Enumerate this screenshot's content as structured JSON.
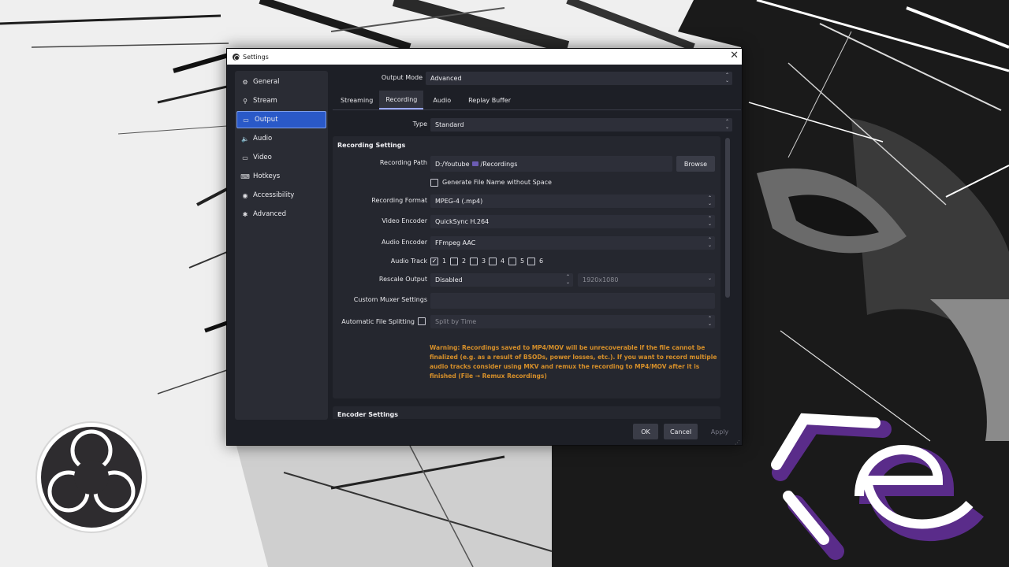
{
  "window": {
    "title": "Settings",
    "close_glyph": "✕"
  },
  "sidebar": {
    "items": [
      {
        "label": "General",
        "icon": "gear-icon",
        "glyph": "⚙"
      },
      {
        "label": "Stream",
        "icon": "antenna-icon",
        "glyph": "⚲"
      },
      {
        "label": "Output",
        "icon": "output-icon",
        "glyph": "▭",
        "active": true
      },
      {
        "label": "Audio",
        "icon": "speaker-icon",
        "glyph": "🔈"
      },
      {
        "label": "Video",
        "icon": "monitor-icon",
        "glyph": "▭"
      },
      {
        "label": "Hotkeys",
        "icon": "keyboard-icon",
        "glyph": "⌨"
      },
      {
        "label": "Accessibility",
        "icon": "accessibility-icon",
        "glyph": "◉"
      },
      {
        "label": "Advanced",
        "icon": "wrench-icon",
        "glyph": "✱"
      }
    ]
  },
  "output_mode": {
    "label": "Output Mode",
    "value": "Advanced"
  },
  "tabs": [
    "Streaming",
    "Recording",
    "Audio",
    "Replay Buffer"
  ],
  "type": {
    "label": "Type",
    "value": "Standard"
  },
  "recording": {
    "section_title": "Recording Settings",
    "path_label": "Recording Path",
    "path_part1": "D:/Youtube",
    "path_part2": "/Recordings",
    "browse_label": "Browse",
    "gen_filename_label": "Generate File Name without Space",
    "format_label": "Recording Format",
    "format_value": "MPEG-4 (.mp4)",
    "video_encoder_label": "Video Encoder",
    "video_encoder_value": "QuickSync H.264",
    "audio_encoder_label": "Audio Encoder",
    "audio_encoder_value": "FFmpeg AAC",
    "audio_track_label": "Audio Track",
    "tracks": [
      {
        "label": "1",
        "checked": true
      },
      {
        "label": "2",
        "checked": false
      },
      {
        "label": "3",
        "checked": false
      },
      {
        "label": "4",
        "checked": false
      },
      {
        "label": "5",
        "checked": false
      },
      {
        "label": "6",
        "checked": false
      }
    ],
    "check_glyph": "✓",
    "rescale_label": "Rescale Output",
    "rescale_value": "Disabled",
    "rescale_resolution": "1920x1080",
    "muxer_label": "Custom Muxer Settings",
    "muxer_value": "",
    "split_label": "Automatic File Splitting",
    "split_value": "Split by Time",
    "warning": "Warning: Recordings saved to MP4/MOV will be unrecoverable if the file cannot be finalized (e.g. as a result of BSODs, power losses, etc.). If you want to record multiple audio tracks consider using MKV and remux the recording to MP4/MOV after it is finished (File → Remux Recordings)"
  },
  "encoder": {
    "section_title": "Encoder Settings"
  },
  "buttons": {
    "ok": "OK",
    "cancel": "Cancel",
    "apply": "Apply"
  },
  "glyphs": {
    "spin": "⌃\n⌄",
    "chevron": "⌄"
  },
  "colors": {
    "window_bg": "#1d1f26",
    "sidebar_bg": "#2a2c34",
    "accent": "#2a59c8",
    "warning": "#d7902a"
  }
}
